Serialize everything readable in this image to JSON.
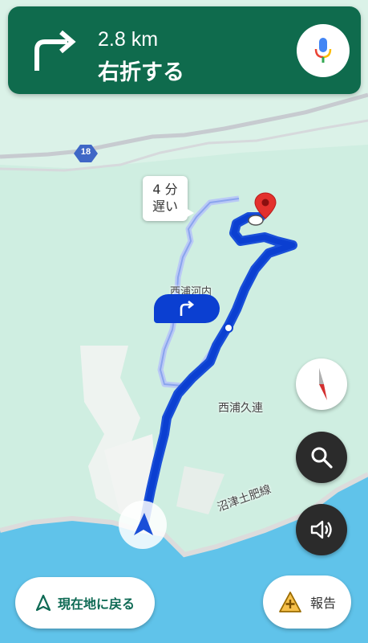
{
  "navigation": {
    "distance": "2.8 km",
    "instruction": "右折する",
    "maneuver_icon": "turn-right-icon",
    "voice_icon": "microphone-icon"
  },
  "map": {
    "alternate_route": {
      "delay_line1": "4 分",
      "delay_line2": "遅い"
    },
    "route_shield": "18",
    "place_labels": {
      "nishiura_kawachi": "西浦河内",
      "nishiura_kure": "西浦久連",
      "numazu_toi": "沼津土肥線"
    },
    "next_turn_icon": "turn-right-icon",
    "destination_icon": "red-pin-icon",
    "current_location_icon": "navigation-arrow-icon"
  },
  "controls": {
    "compass_icon": "compass-icon",
    "search_icon": "search-icon",
    "sound_icon": "speaker-icon",
    "recenter_label": "現在地に戻る",
    "recenter_icon": "navigation-outline-icon",
    "report_label": "報告",
    "report_icon": "report-plus-icon"
  },
  "colors": {
    "banner": "#0f6b4d",
    "route": "#0b3fd1",
    "alternate_route": "#b9c9f5",
    "water": "#60c3ea",
    "land": "#cfeee1",
    "destination": "#e3312d"
  }
}
